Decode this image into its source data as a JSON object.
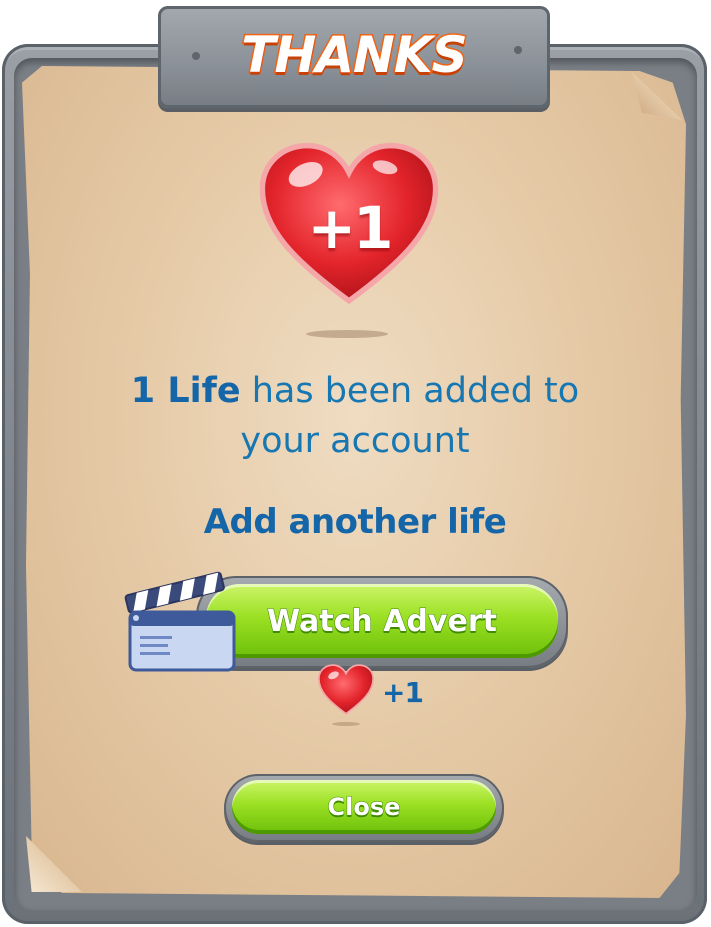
{
  "dialog": {
    "title": "THANKS",
    "reward_badge": "+1",
    "message_highlight": "1 Life",
    "message_line1_rest": " has been added to",
    "message_line2": "your account",
    "subheading": "Add another life",
    "watch_button_label": "Watch Advert",
    "watch_reward": "+1",
    "close_button_label": "Close"
  },
  "icons": {
    "title_plate": "stone-plate",
    "big_heart": "heart-icon",
    "small_heart": "heart-icon",
    "clapperboard": "clapperboard-icon"
  },
  "colors": {
    "text_blue": "#1566a8",
    "button_green": "#9be023",
    "title_orange": "#ee5a12",
    "heart_red": "#e3242b",
    "paper": "#e6cba8",
    "frame_stone": "#8a9097"
  }
}
